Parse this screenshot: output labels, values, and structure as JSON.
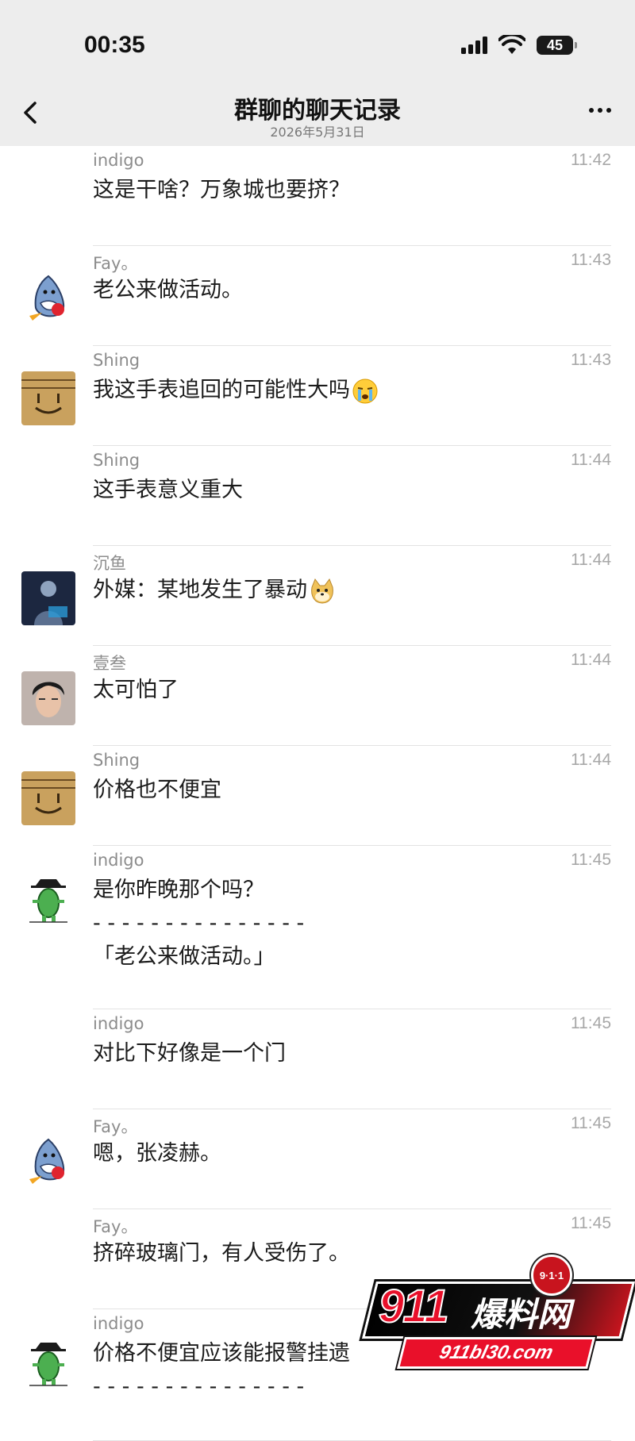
{
  "status_bar": {
    "time": "00:35",
    "battery": "45"
  },
  "nav": {
    "title": "群聊的聊天记录",
    "subtitle": "2026年5月31日"
  },
  "messages": [
    {
      "sender": "indigo",
      "time": "11:42",
      "lines": [
        "这是干啥？万象城也要挤？"
      ],
      "avatar": "none"
    },
    {
      "sender": "Fay。",
      "time": "11:43",
      "lines": [
        "老公来做活动。"
      ],
      "avatar": "shark-cartoon"
    },
    {
      "sender": "Shing",
      "time": "11:43",
      "lines": [
        "我这手表追回的可能性大吗"
      ],
      "emoji": "crying-face",
      "avatar": "smiley-wood"
    },
    {
      "sender": "Shing",
      "time": "11:44",
      "lines": [
        "这手表意义重大"
      ],
      "avatar": "none"
    },
    {
      "sender": "沉鱼",
      "time": "11:44",
      "lines": [
        "外媒：某地发生了暴动"
      ],
      "emoji": "doge-face",
      "avatar": "dark-figure"
    },
    {
      "sender": "壹叁",
      "time": "11:44",
      "lines": [
        "太可怕了"
      ],
      "avatar": "person-photo"
    },
    {
      "sender": "Shing",
      "time": "11:44",
      "lines": [
        "价格也不便宜"
      ],
      "avatar": "smiley-wood"
    },
    {
      "sender": "indigo",
      "time": "11:45",
      "lines": [
        "是你昨晚那个吗？",
        "- - - - - - - - - - - - - - -",
        "「老公来做活动。」"
      ],
      "avatar": "green-cowboy"
    },
    {
      "sender": "indigo",
      "time": "11:45",
      "lines": [
        "对比下好像是一个门"
      ],
      "avatar": "none"
    },
    {
      "sender": "Fay。",
      "time": "11:45",
      "lines": [
        "嗯，张凌赫。"
      ],
      "avatar": "shark-cartoon"
    },
    {
      "sender": "Fay。",
      "time": "11:45",
      "lines": [
        "挤碎玻璃门，有人受伤了。"
      ],
      "avatar": "none"
    },
    {
      "sender": "indigo",
      "time": "11:45",
      "lines": [
        "价格不便宜应该能报警挂遗",
        "- - - - - - - - - - - - - - -"
      ],
      "avatar": "green-cowboy"
    }
  ],
  "watermark": {
    "badge": "9·1·1",
    "number": "911",
    "name": "爆料网",
    "url": "911bl30.com"
  },
  "colors": {
    "header_bg": "#ededed",
    "body_bg": "#ffffff",
    "divider": "#e3e3e3",
    "brand_red": "#e9102a"
  }
}
